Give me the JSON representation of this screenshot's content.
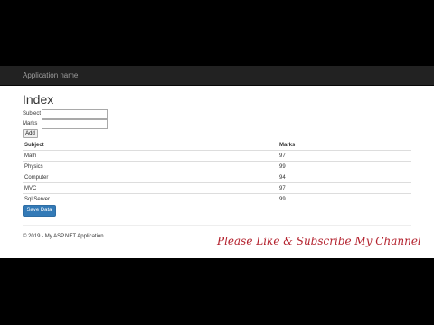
{
  "navbar": {
    "brand": "Application name"
  },
  "page": {
    "title": "Index"
  },
  "form": {
    "subject_label": "Subject",
    "subject_value": "",
    "marks_label": "Marks",
    "marks_value": "",
    "add_label": "Add"
  },
  "table": {
    "headers": [
      "Subject",
      "Marks"
    ],
    "rows": [
      [
        "Math",
        "97"
      ],
      [
        "Physics",
        "99"
      ],
      [
        "Computer",
        "94"
      ],
      [
        "MVC",
        "97"
      ],
      [
        "Sql Server",
        "99"
      ]
    ]
  },
  "save_label": "Save Data",
  "footer": {
    "text": "© 2019 - My ASP.NET Application"
  },
  "overlay": {
    "text": "Please Like & Subscribe My Channel"
  },
  "colors": {
    "navbar": "#222222",
    "primary_button": "#337ab7",
    "overlay_text": "#b3202c",
    "letterbox": "#000000"
  }
}
